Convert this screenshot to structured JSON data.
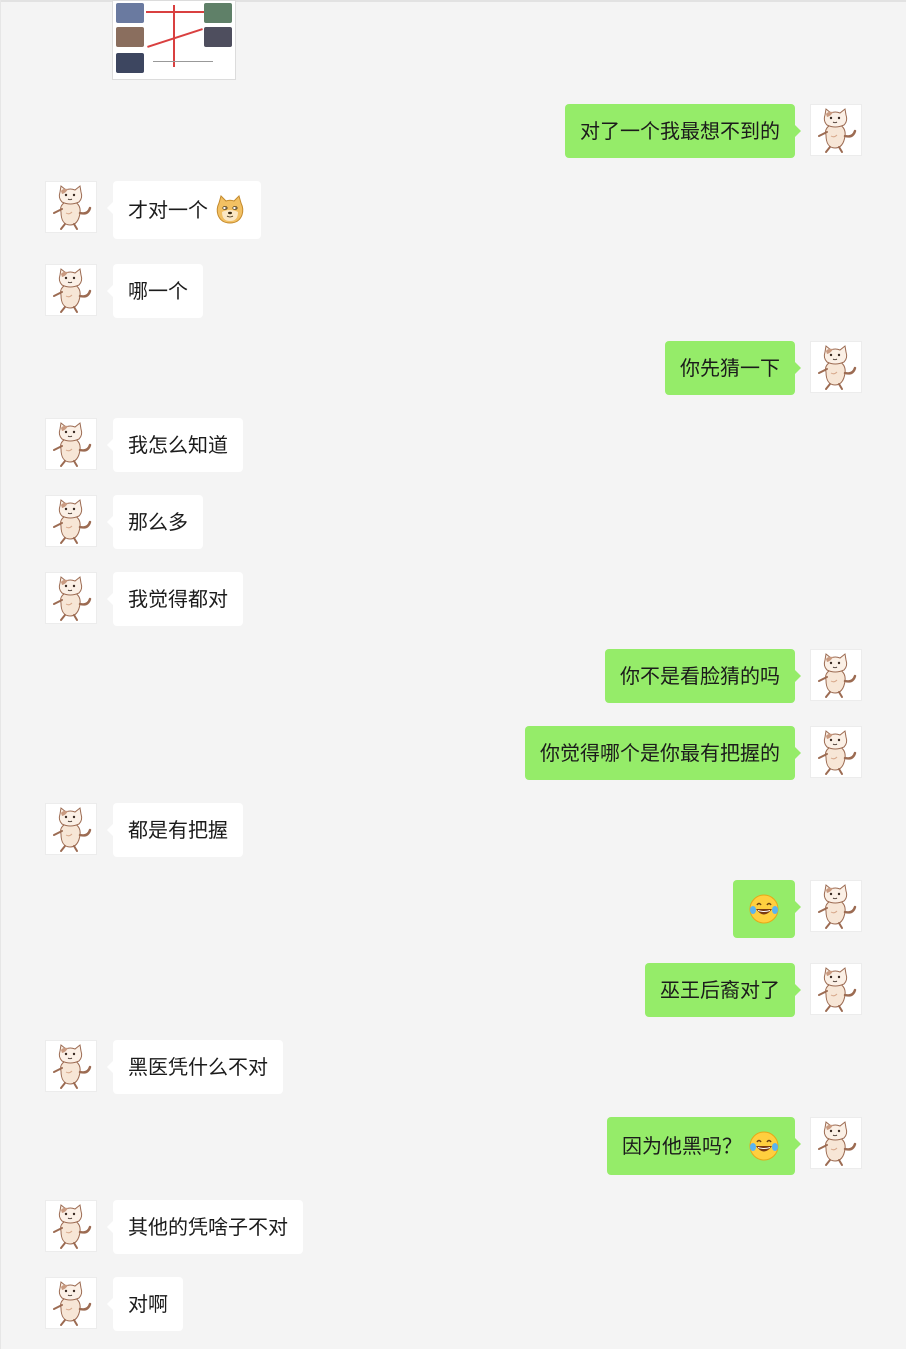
{
  "messages": [
    {
      "side": "right",
      "text": "对了一个我最想不到的"
    },
    {
      "side": "left",
      "text": "才对一个",
      "emoji": "doge-emoji"
    },
    {
      "side": "left",
      "text": "哪一个"
    },
    {
      "side": "right",
      "text": "你先猜一下"
    },
    {
      "side": "left",
      "text": "我怎么知道"
    },
    {
      "side": "left",
      "text": "那么多"
    },
    {
      "side": "left",
      "text": "我觉得都对"
    },
    {
      "side": "right",
      "text": "你不是看脸猜的吗"
    },
    {
      "side": "right",
      "text": "你觉得哪个是你最有把握的"
    },
    {
      "side": "left",
      "text": "都是有把握"
    },
    {
      "side": "right",
      "text": "",
      "emoji": "tears-of-joy-emoji"
    },
    {
      "side": "right",
      "text": "巫王后裔对了"
    },
    {
      "side": "left",
      "text": "黑医凭什么不对"
    },
    {
      "side": "right",
      "text": "因为他黑吗？",
      "emoji": "tears-of-joy-emoji"
    },
    {
      "side": "left",
      "text": "其他的凭啥子不对"
    },
    {
      "side": "left",
      "text": "对啊"
    }
  ],
  "colors": {
    "background": "#f4f4f4",
    "self_bubble": "#95ec69",
    "other_bubble": "#ffffff",
    "text": "#1b1b1b"
  },
  "icons": {
    "avatar": "cat-avatar",
    "shared_image": "relationship-chart-thumbnail"
  }
}
